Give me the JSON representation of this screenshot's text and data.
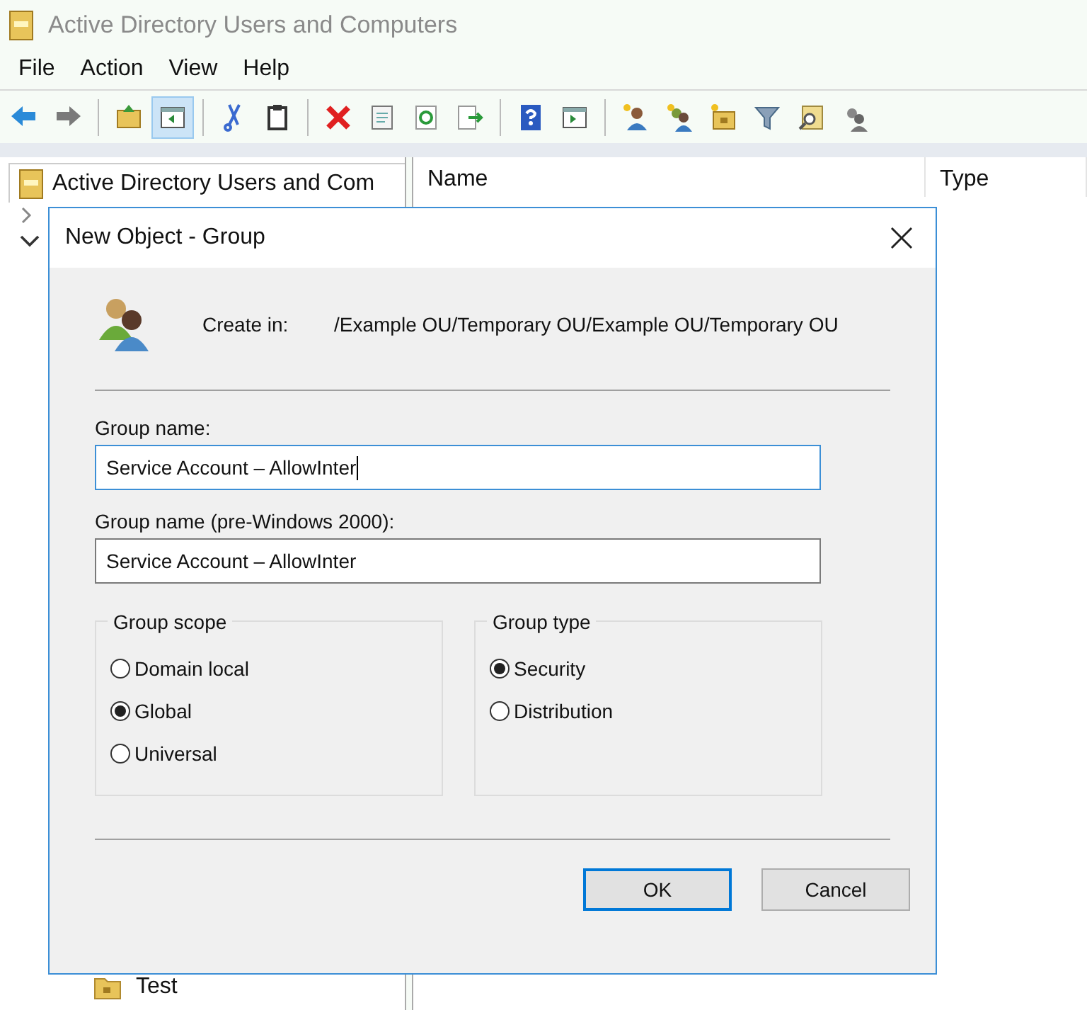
{
  "window": {
    "title": "Active Directory Users and Computers"
  },
  "menu": [
    "File",
    "Action",
    "View",
    "Help"
  ],
  "toolbar": [
    {
      "selected": false
    },
    {
      "selected": false
    },
    {
      "selected": false
    },
    {
      "selected": true
    },
    {
      "selected": false
    },
    {
      "selected": false
    },
    {
      "selected": false
    },
    {
      "selected": false
    },
    {
      "selected": false
    },
    {
      "selected": false
    },
    {
      "selected": false
    },
    {
      "selected": false
    },
    {
      "selected": false
    },
    {
      "selected": false
    },
    {
      "selected": false
    },
    {
      "selected": false
    },
    {
      "selected": false
    },
    {
      "selected": false
    }
  ],
  "tree": {
    "root": "Active Directory Users and Com",
    "items": [
      "Test"
    ]
  },
  "list": {
    "columns": [
      "Name",
      "Type"
    ]
  },
  "dialog": {
    "title": "New Object - Group",
    "create_in_label": "Create in:",
    "create_in_path": "/Example OU/Temporary OU/Example OU/Temporary OU",
    "fields": [
      {
        "label": "Group name:",
        "value": "Service Account – AllowInter",
        "focused": true
      },
      {
        "label": "Group name (pre-Windows 2000):",
        "value": "Service Account – AllowInter",
        "focused": false
      }
    ],
    "groups": [
      {
        "title": "Group scope",
        "options": [
          {
            "label": "Domain local",
            "selected": false
          },
          {
            "label": "Global",
            "selected": true
          },
          {
            "label": "Universal",
            "selected": false
          }
        ]
      },
      {
        "title": "Group type",
        "options": [
          {
            "label": "Security",
            "selected": true
          },
          {
            "label": "Distribution",
            "selected": false
          }
        ]
      }
    ],
    "buttons": [
      {
        "label": "OK",
        "default": true
      },
      {
        "label": "Cancel",
        "default": false
      }
    ]
  }
}
